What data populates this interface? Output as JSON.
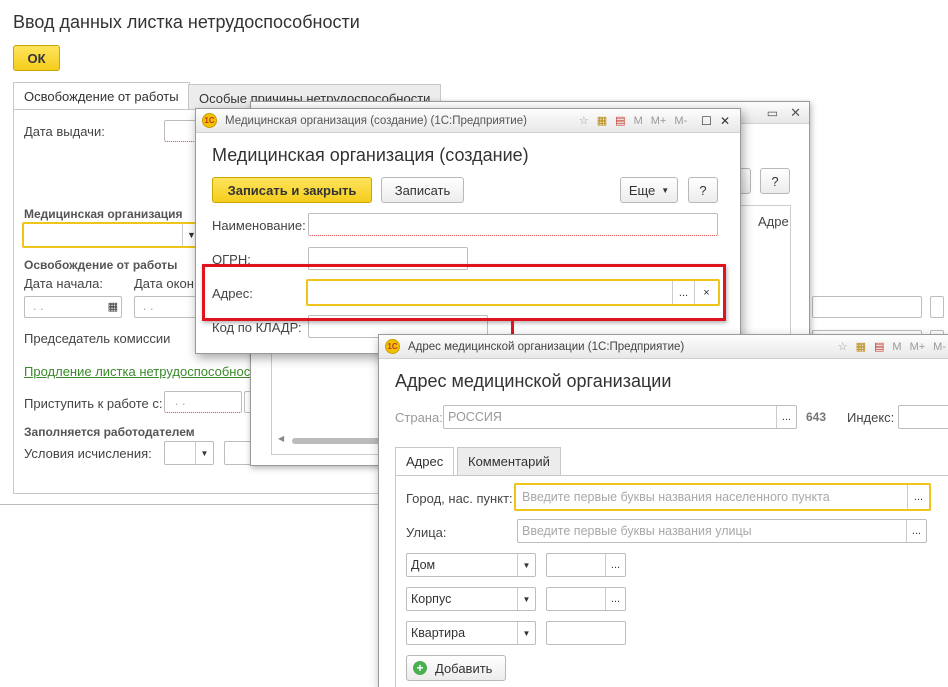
{
  "main": {
    "title": "Ввод данных листка нетрудоспособности",
    "ok_label": "ОК",
    "tabs": [
      "Освобождение от работы",
      "Особые причины нетрудоспособности"
    ],
    "date_issued_label": "Дата выдачи:",
    "med_org_group": "Медицинская организация",
    "release_group": "Освобождение от работы",
    "start_date_label": "Дата начала:",
    "end_date_label": "Дата окон",
    "commission_chair_label": "Председатель комиссии",
    "extension_link": "Продление листка нетрудоспособност",
    "return_label": "Приступить к работе с:",
    "employer_group": "Заполняется работодателем",
    "calc_conditions_label": "Условия исчисления:",
    "bg_help_label": "?"
  },
  "med_org_dialog": {
    "window_title": "Медицинская организация (создание)  (1С:Предприятие)",
    "heading": "Медицинская организация (создание)",
    "save_close_label": "Записать и закрыть",
    "save_label": "Записать",
    "more_label": "Еще",
    "help_label": "?",
    "name_label": "Наименование:",
    "ogrn_label": "ОГРН:",
    "address_label": "Адрес:",
    "kladr_label": "Код по КЛАДР:",
    "bg_column_header": "Адре"
  },
  "address_dialog": {
    "window_title": "Адрес медицинской организации  (1С:Предприятие)",
    "heading": "Адрес медицинской организации",
    "country_label": "Страна:",
    "country_value": "РОССИЯ",
    "country_code": "643",
    "index_label": "Индекс:",
    "tabs": [
      "Адрес",
      "Комментарий"
    ],
    "city_label": "Город, нас. пункт:",
    "city_placeholder": "Введите первые буквы названия населенного пункта",
    "street_label": "Улица:",
    "street_placeholder": "Введите первые буквы названия улицы",
    "house_type": "Дом",
    "building_type": "Корпус",
    "apartment_type": "Квартира",
    "add_label": "Добавить"
  },
  "titlebar_icons": {
    "m": "M",
    "m_plus": "M+",
    "m_minus": "M-"
  },
  "colors": {
    "accent_yellow": "#f4cd1c",
    "highlight_red": "#e0141e",
    "link_green": "#3a8a2a"
  }
}
